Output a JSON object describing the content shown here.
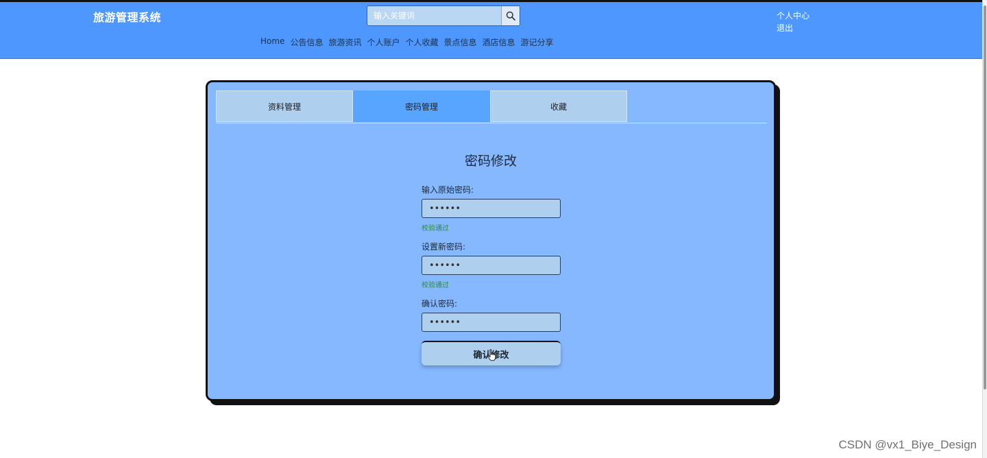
{
  "header": {
    "brand": "旅游管理系统",
    "search_placeholder": "输入关键词",
    "nav": [
      "Home",
      "公告信息",
      "旅游资讯",
      "个人账户",
      "个人收藏",
      "景点信息",
      "酒店信息",
      "游记分享"
    ],
    "user_center": "个人中心",
    "logout": "退出"
  },
  "tabs": [
    {
      "label": "资料管理",
      "active": false
    },
    {
      "label": "密码管理",
      "active": true
    },
    {
      "label": "收藏",
      "active": false
    }
  ],
  "form": {
    "title": "密码修改",
    "fields": [
      {
        "label": "输入原始密码:",
        "value": "123456",
        "hint": "校验通过"
      },
      {
        "label": "设置新密码:",
        "value": "123456",
        "hint": "校验通过"
      },
      {
        "label": "确认密码:",
        "value": "123456",
        "hint": ""
      }
    ],
    "submit": "确认修改"
  },
  "watermark": "CSDN @vx1_Biye_Design",
  "colors": {
    "header_bg": "#4d97ff",
    "panel_bg": "#85b8ff",
    "active_tab": "#58a5ff",
    "input_bg": "#aecfee",
    "hint": "#2e8b3a"
  }
}
